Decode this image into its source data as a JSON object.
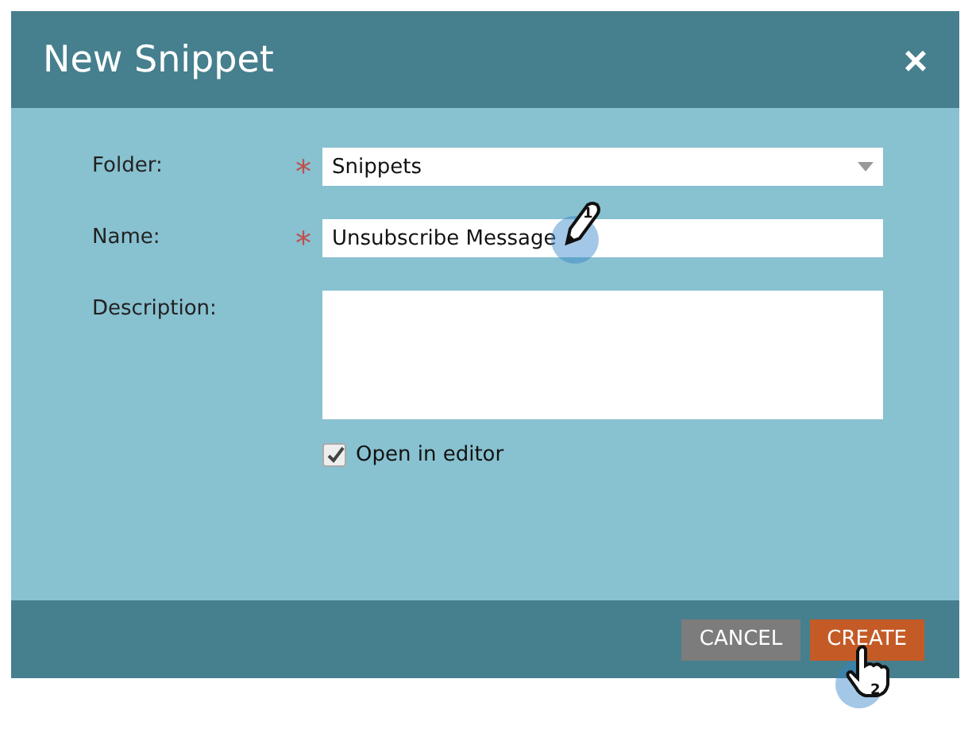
{
  "dialog": {
    "title": "New Snippet",
    "close": "×"
  },
  "fields": [
    {
      "kind": "select",
      "label": "Folder:",
      "required": true,
      "value": "Snippets"
    },
    {
      "kind": "text",
      "label": "Name:",
      "required": true,
      "value": "Unsubscribe Message"
    },
    {
      "kind": "textarea",
      "label": "Description:",
      "required": false
    }
  ],
  "required_mark": "*",
  "open_in_editor": {
    "label": "Open in editor",
    "checked": true
  },
  "buttons": [
    {
      "label": "CANCEL",
      "kind": "secondary"
    },
    {
      "label": "CREATE",
      "kind": "primary"
    }
  ],
  "step_markers": [
    {
      "kind": "pencil",
      "number": "1"
    },
    {
      "kind": "hand",
      "number": "2"
    }
  ]
}
